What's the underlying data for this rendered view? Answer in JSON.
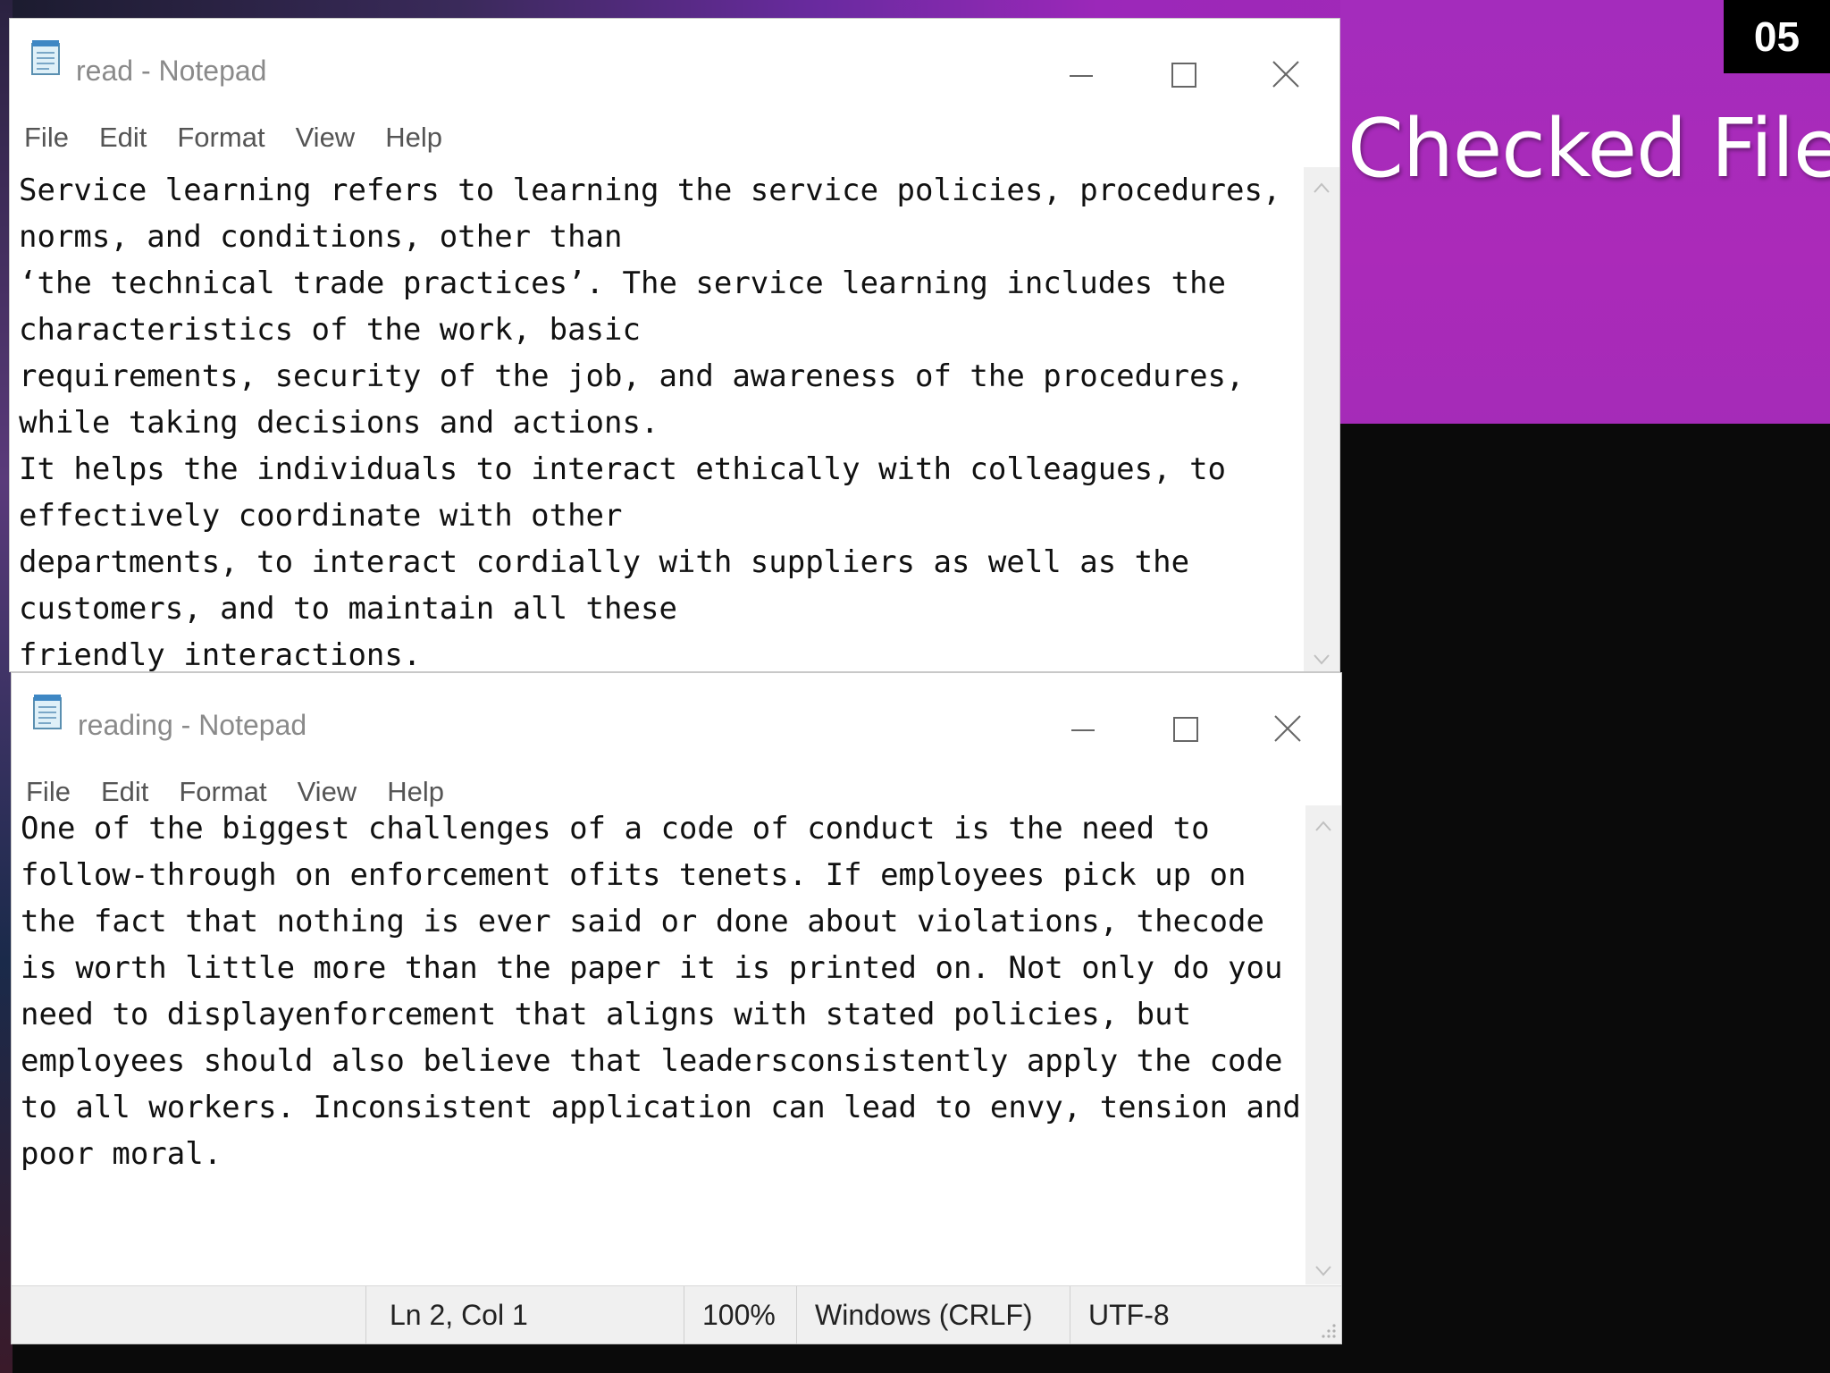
{
  "slide": {
    "number": "05",
    "title": "Checked File"
  },
  "windows": [
    {
      "title": "read - Notepad",
      "menu": [
        "File",
        "Edit",
        "Format",
        "View",
        "Help"
      ],
      "lines": [
        "Service learning refers to learning the service policies, procedures,",
        "norms, and conditions, other than",
        "‘the technical trade practices’. The service learning includes the",
        "characteristics of the work, basic",
        "requirements, security of the job, and awareness of the procedures,",
        "while taking decisions and actions.",
        "It helps the individuals to interact ethically with colleagues, to",
        "effectively coordinate with other",
        "departments, to interact cordially with suppliers as well as the",
        "customers, and to maintain all these",
        "friendly interactions."
      ]
    },
    {
      "title": "reading - Notepad",
      "menu": [
        "File",
        "Edit",
        "Format",
        "View",
        "Help"
      ],
      "lines": [
        "One of the biggest challenges of a code of conduct is the need to",
        "follow-through on enforcement ofits tenets. If employees pick up on",
        "the fact that nothing is ever said or done about violations, thecode",
        "is worth little more than the paper it is printed on. Not only do you",
        "need to displayenforcement that aligns with stated policies, but",
        "employees should also believe that leadersconsistently apply the code",
        "to all workers. Inconsistent application can lead to envy, tension and",
        "poor moral."
      ],
      "status": {
        "position": "Ln 2, Col 1",
        "zoom": "100%",
        "line_endings": "Windows (CRLF)",
        "encoding": "UTF-8"
      }
    }
  ]
}
